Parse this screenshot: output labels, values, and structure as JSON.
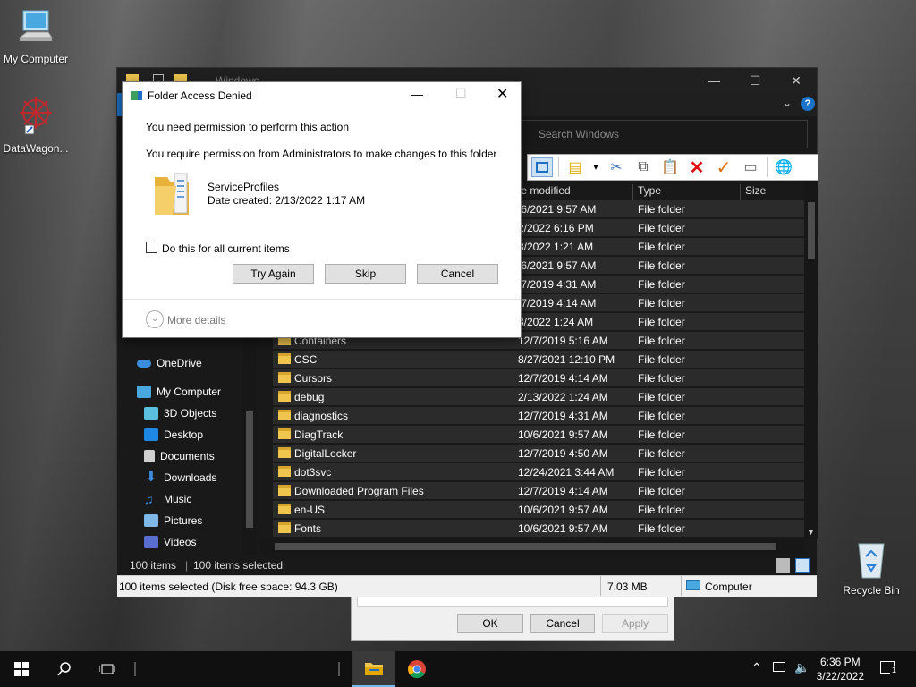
{
  "desktop": {
    "icons": [
      {
        "label": "My Computer"
      },
      {
        "label": "DataWagon..."
      },
      {
        "label": "Recycle Bin"
      }
    ]
  },
  "explorer": {
    "title": "Windows",
    "search_placeholder": "Search Windows",
    "columns": {
      "modified": "te modified",
      "type": "Type",
      "size": "Size"
    },
    "nav": [
      {
        "label": "OneDrive"
      },
      {
        "label": "My Computer"
      },
      {
        "label": "3D Objects"
      },
      {
        "label": "Desktop"
      },
      {
        "label": "Documents"
      },
      {
        "label": "Downloads"
      },
      {
        "label": "Music"
      },
      {
        "label": "Pictures"
      },
      {
        "label": "Videos"
      }
    ],
    "rows": [
      {
        "name": "",
        "modified": "/6/2021 9:57 AM",
        "type": "File folder"
      },
      {
        "name": "",
        "modified": "2/2022 6:16 PM",
        "type": "File folder"
      },
      {
        "name": "",
        "modified": "3/2022 1:21 AM",
        "type": "File folder"
      },
      {
        "name": "",
        "modified": "/6/2021 9:57 AM",
        "type": "File folder"
      },
      {
        "name": "",
        "modified": "/7/2019 4:31 AM",
        "type": "File folder"
      },
      {
        "name": "",
        "modified": "/7/2019 4:14 AM",
        "type": "File folder"
      },
      {
        "name": "",
        "modified": "3/2022 1:24 AM",
        "type": "File folder"
      },
      {
        "name": "Containers",
        "modified": "12/7/2019 5:16 AM",
        "type": "File folder"
      },
      {
        "name": "CSC",
        "modified": "8/27/2021 12:10 PM",
        "type": "File folder"
      },
      {
        "name": "Cursors",
        "modified": "12/7/2019 4:14 AM",
        "type": "File folder"
      },
      {
        "name": "debug",
        "modified": "2/13/2022 1:24 AM",
        "type": "File folder"
      },
      {
        "name": "diagnostics",
        "modified": "12/7/2019 4:31 AM",
        "type": "File folder"
      },
      {
        "name": "DiagTrack",
        "modified": "10/6/2021 9:57 AM",
        "type": "File folder"
      },
      {
        "name": "DigitalLocker",
        "modified": "12/7/2019 4:50 AM",
        "type": "File folder"
      },
      {
        "name": "dot3svc",
        "modified": "12/24/2021 3:44 AM",
        "type": "File folder"
      },
      {
        "name": "Downloaded Program Files",
        "modified": "12/7/2019 4:14 AM",
        "type": "File folder"
      },
      {
        "name": "en-US",
        "modified": "10/6/2021 9:57 AM",
        "type": "File folder"
      },
      {
        "name": "Fonts",
        "modified": "10/6/2021 9:57 AM",
        "type": "File folder"
      }
    ],
    "status": {
      "items": "100 items",
      "selected": "100 items selected",
      "bottom_left": "100 items selected (Disk free space: 94.3 GB)",
      "size": "7.03 MB",
      "location": "Computer"
    }
  },
  "properties_dialog": {
    "ok": "OK",
    "cancel": "Cancel",
    "apply": "Apply"
  },
  "access_dialog": {
    "title": "Folder Access Denied",
    "line1": "You need permission to perform this action",
    "line2": "You require permission from Administrators to make changes to this folder",
    "folder_name": "ServiceProfiles",
    "date_created": "Date created: 2/13/2022 1:17 AM",
    "checkbox_label": "Do this for all current items",
    "try_again": "Try Again",
    "skip": "Skip",
    "cancel": "Cancel",
    "more_details": "More details"
  },
  "taskbar": {
    "time": "6:36 PM",
    "date": "3/22/2022",
    "notifications": "1"
  }
}
